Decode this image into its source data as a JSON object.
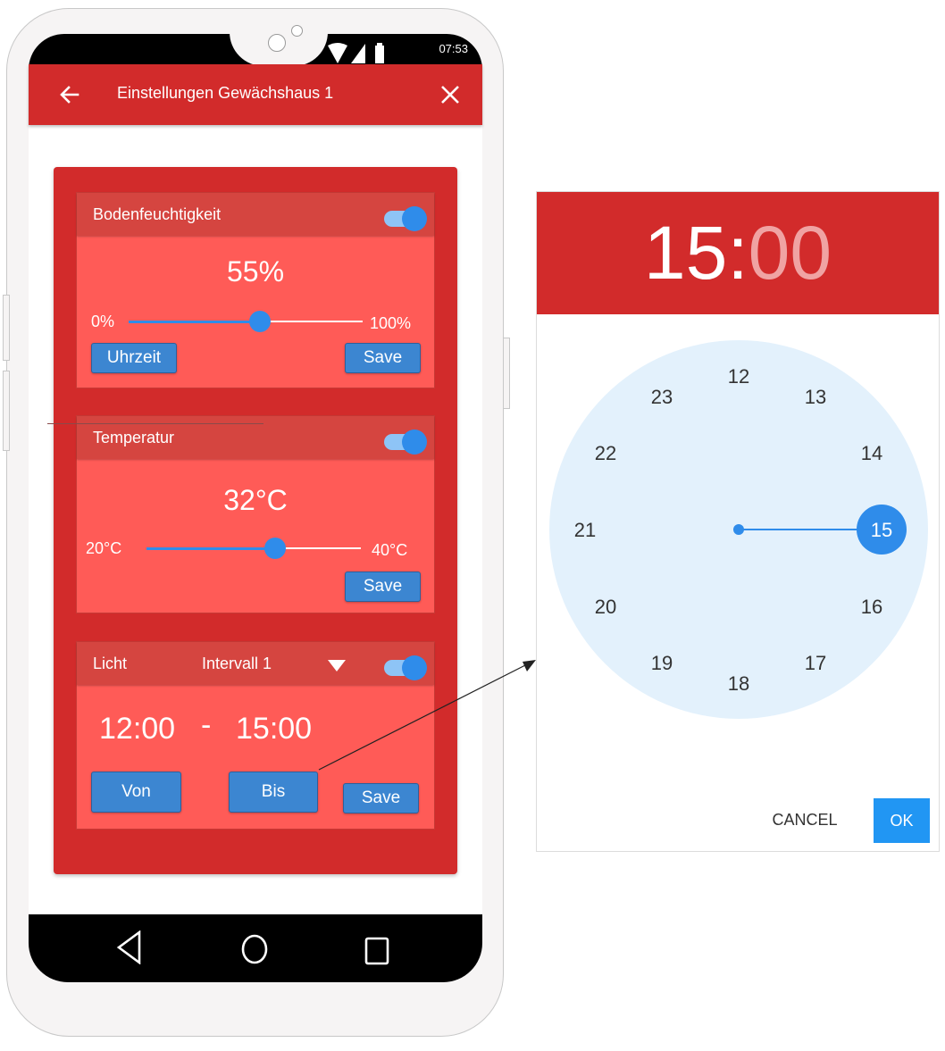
{
  "status_bar": {
    "time": "07:53"
  },
  "app_bar": {
    "title": "Einstellungen Gewächshaus 1"
  },
  "cards": {
    "soil": {
      "title": "Bodenfeuchtigkeit",
      "enabled": true,
      "value_text": "55%",
      "min_label": "0%",
      "max_label": "100%",
      "slider_fraction": 0.56,
      "time_button": "Uhrzeit",
      "save_button": "Save"
    },
    "temperature": {
      "title": "Temperatur",
      "enabled": true,
      "value_text": "32°C",
      "min_label": "20°C",
      "max_label": "40°C",
      "slider_fraction": 0.6,
      "save_button": "Save"
    },
    "light": {
      "title": "Licht",
      "enabled": true,
      "interval_selected": "Intervall 1",
      "from_time": "12:00",
      "separator": "-",
      "to_time": "15:00",
      "from_button": "Von",
      "to_button": "Bis",
      "save_button": "Save"
    }
  },
  "time_picker": {
    "hours": "15",
    "colon": ":",
    "minutes": "00",
    "dial_labels": [
      "12",
      "13",
      "14",
      "15",
      "16",
      "17",
      "18",
      "19",
      "20",
      "21",
      "22",
      "23"
    ],
    "selected_hour": "15",
    "cancel_label": "CANCEL",
    "ok_label": "OK"
  },
  "colors": {
    "primary_red": "#d22b2b",
    "card_red": "#ff5b57",
    "accent_blue": "#2f8cea",
    "dial_background": "#e3f1fc"
  },
  "icons": {
    "back": "arrow-left-icon",
    "close": "close-icon",
    "dropdown": "triangle-down-icon",
    "nav_back": "triangle-back-icon",
    "nav_home": "circle-home-icon",
    "nav_recent": "square-recent-icon"
  }
}
